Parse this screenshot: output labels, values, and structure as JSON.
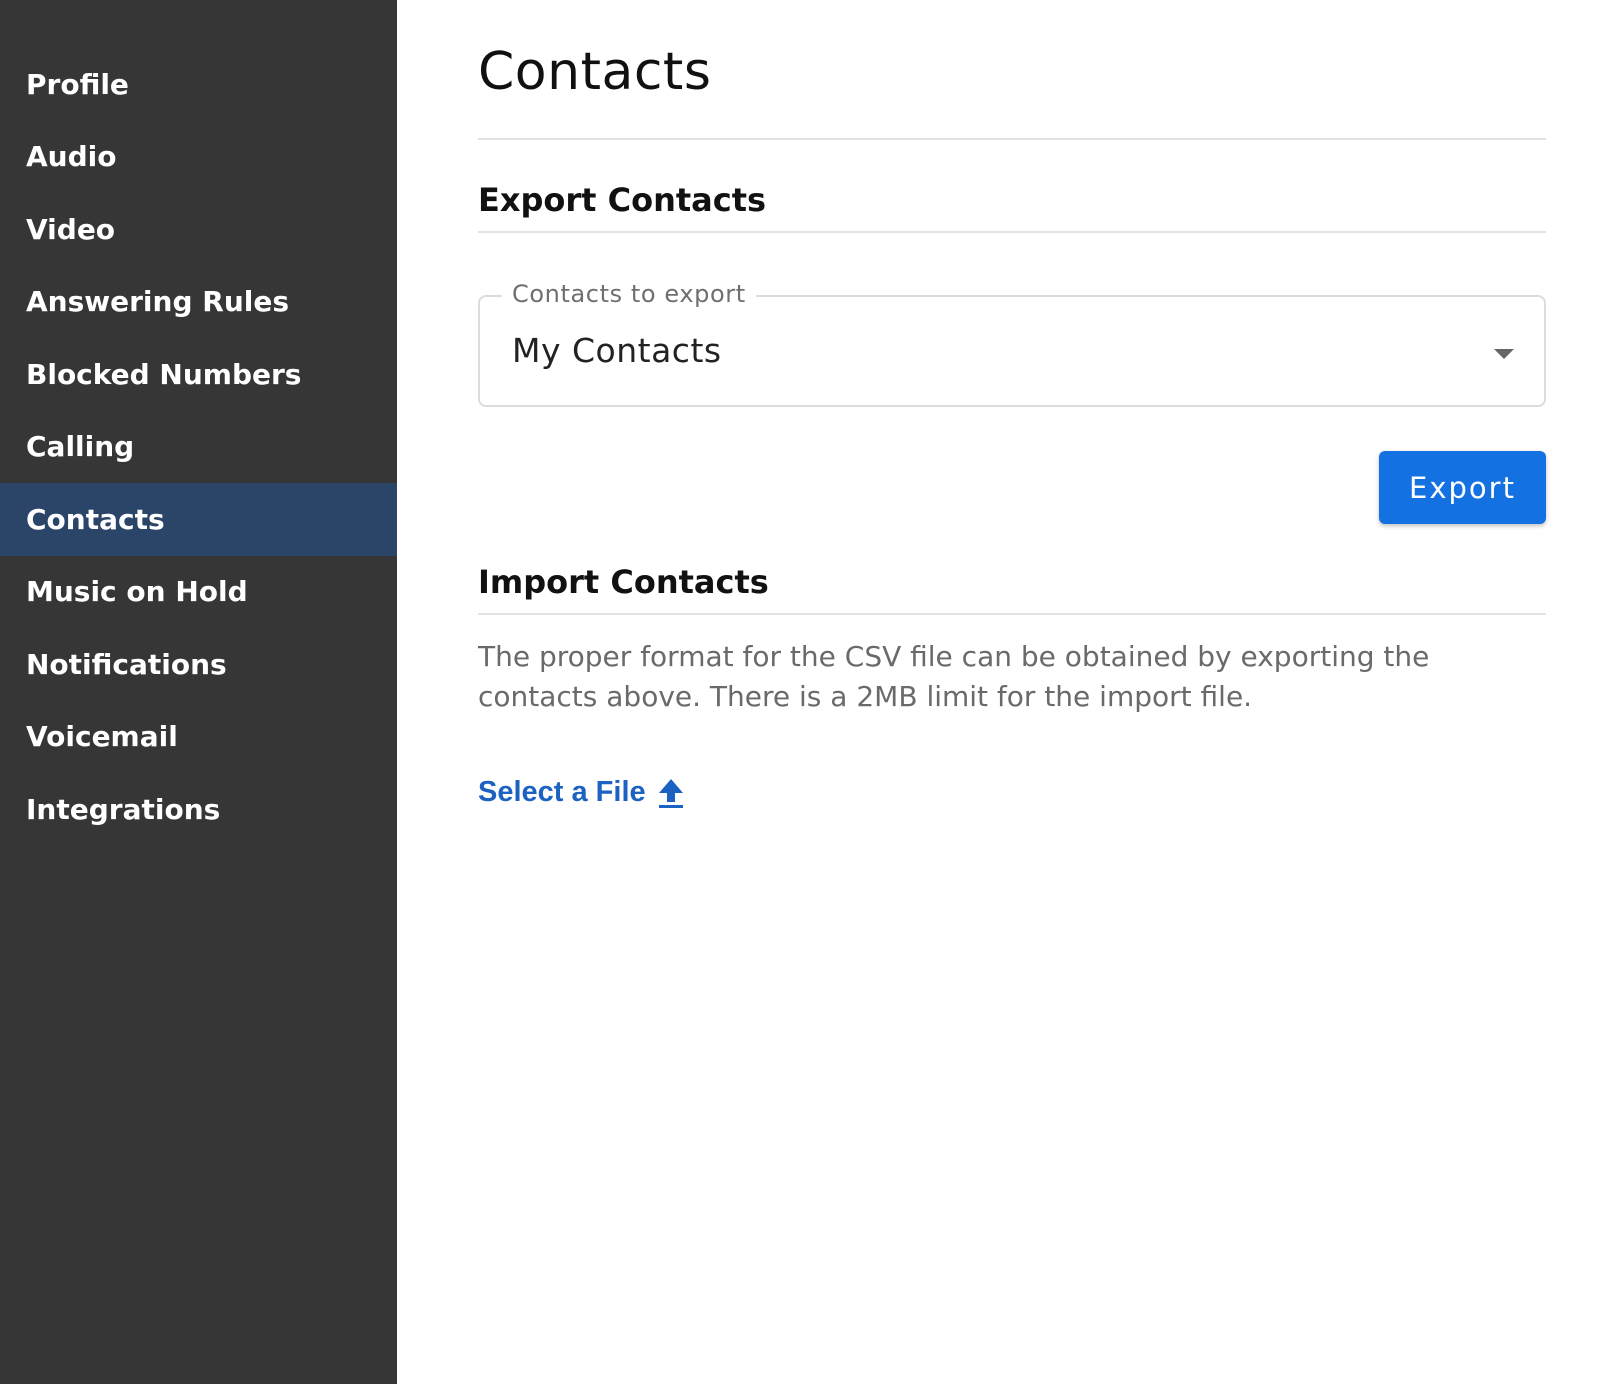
{
  "sidebar": {
    "items": [
      {
        "label": "Profile"
      },
      {
        "label": "Audio"
      },
      {
        "label": "Video"
      },
      {
        "label": "Answering Rules"
      },
      {
        "label": "Blocked Numbers"
      },
      {
        "label": "Calling"
      },
      {
        "label": "Contacts"
      },
      {
        "label": "Music on Hold"
      },
      {
        "label": "Notifications"
      },
      {
        "label": "Voicemail"
      },
      {
        "label": "Integrations"
      }
    ],
    "active_index": 6
  },
  "main": {
    "title": "Contacts",
    "export": {
      "heading": "Export Contacts",
      "select_label": "Contacts to export",
      "select_value": "My Contacts",
      "button_label": "Export"
    },
    "import": {
      "heading": "Import Contacts",
      "description": "The proper format for the CSV file can be obtained by exporting the contacts above. There is a 2MB limit for the import file.",
      "select_file_label": "Select a File",
      "select_file_icon": "upload-icon"
    }
  },
  "colors": {
    "sidebar_bg": "#363636",
    "sidebar_active_bg": "#2a4568",
    "primary_button": "#1471e2",
    "link": "#1c62c2"
  }
}
